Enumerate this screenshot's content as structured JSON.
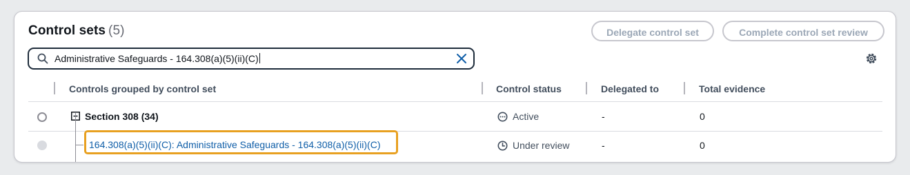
{
  "header": {
    "title": "Control sets",
    "count": "(5)",
    "delegate_label": "Delegate control set",
    "complete_label": "Complete control set review"
  },
  "search": {
    "value": "Administrative Safeguards - 164.308(a)(5)(ii)(C)"
  },
  "columns": [
    {
      "label": "Controls grouped by control set"
    },
    {
      "label": "Control status"
    },
    {
      "label": "Delegated to"
    },
    {
      "label": "Total evidence"
    }
  ],
  "rows": [
    {
      "type": "group",
      "label": "Section 308 (34)",
      "status": "Active",
      "status_icon": "active-status-icon",
      "delegated_to": "-",
      "evidence": "0"
    },
    {
      "type": "control",
      "label": "164.308(a)(5)(ii)(C): Administrative Safeguards - 164.308(a)(5)(ii)(C)",
      "status": "Under review",
      "status_icon": "under-review-status-icon",
      "delegated_to": "-",
      "evidence": "0"
    }
  ],
  "colors": {
    "link": "#0f5ea8",
    "highlight": "#e8a020",
    "disabled_button": "#9ba7b6"
  }
}
